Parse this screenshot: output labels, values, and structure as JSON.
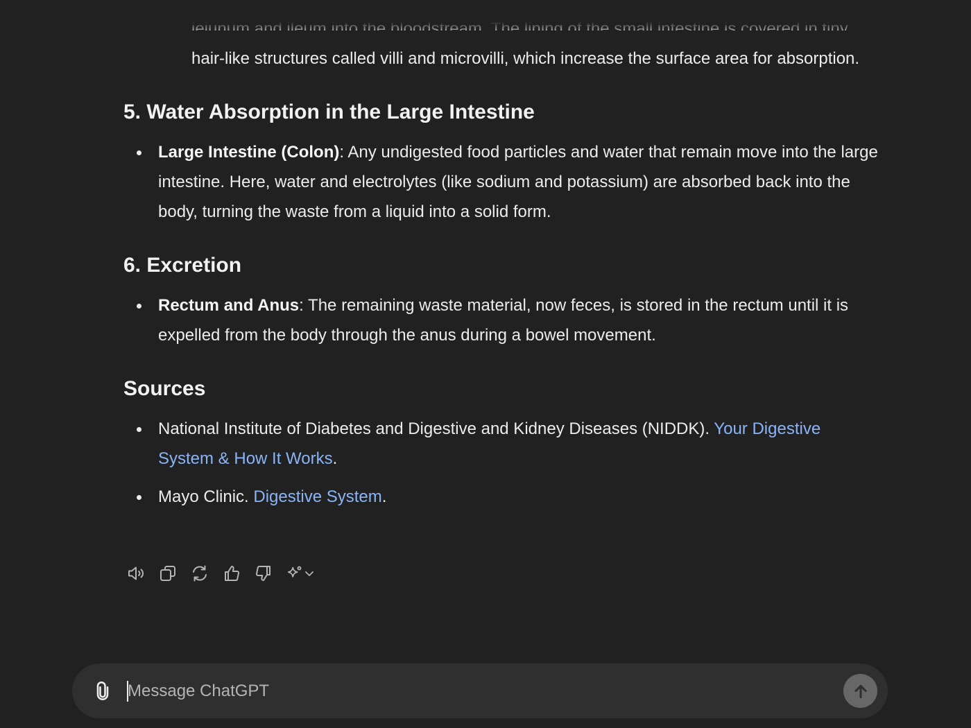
{
  "message": {
    "previous_item": {
      "cutoff_line": "jejunum and ileum into the bloodstream. The lining of the small intestine is covered in tiny",
      "text": "hair-like structures called villi and microvilli, which increase the surface area for absorption."
    },
    "sections": [
      {
        "heading": "5. Water Absorption in the Large Intestine",
        "items": [
          {
            "term": "Large Intestine (Colon)",
            "text": ": Any undigested food particles and water that remain move into the large intestine. Here, water and electrolytes (like sodium and potassium) are absorbed back into the body, turning the waste from a liquid into a solid form."
          }
        ]
      },
      {
        "heading": "6. Excretion",
        "items": [
          {
            "term": "Rectum and Anus",
            "text": ": The remaining waste material, now feces, is stored in the rectum until it is expelled from the body through the anus during a bowel movement."
          }
        ]
      }
    ],
    "sources": {
      "heading": "Sources",
      "items": [
        {
          "prefix": "National Institute of Diabetes and Digestive and Kidney Diseases (NIDDK). ",
          "link": "Your Digestive System & How It Works",
          "suffix": "."
        },
        {
          "prefix": "Mayo Clinic. ",
          "link": "Digestive System",
          "suffix": "."
        }
      ]
    }
  },
  "actions": {
    "icons": [
      "speaker-icon",
      "copy-icon",
      "regenerate-icon",
      "thumbs-up-icon",
      "thumbs-down-icon",
      "sparkle-icon",
      "chevron-down-icon"
    ]
  },
  "composer": {
    "placeholder": "Message ChatGPT",
    "value": ""
  },
  "colors": {
    "background": "#212121",
    "composer": "#2f2f2f",
    "link": "#8ab4f8",
    "send_button": "#676767"
  }
}
